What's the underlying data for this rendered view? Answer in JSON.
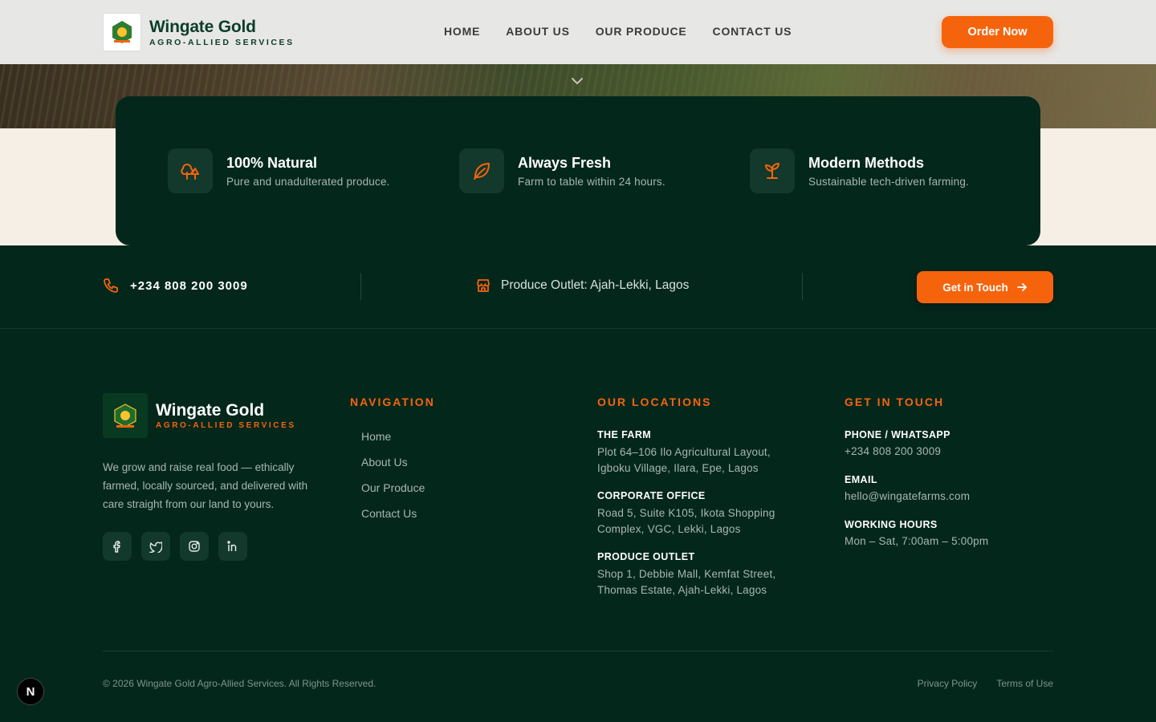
{
  "header": {
    "brand_name": "Wingate Gold",
    "brand_tagline": "AGRO-ALLIED SERVICES",
    "nav": [
      "HOME",
      "ABOUT US",
      "OUR PRODUCE",
      "CONTACT US"
    ],
    "cta_label": "Order Now"
  },
  "features": [
    {
      "title": "100% Natural",
      "desc": "Pure and unadulterated produce.",
      "icon": "trees-icon"
    },
    {
      "title": "Always Fresh",
      "desc": "Farm to table within 24 hours.",
      "icon": "leaf-icon"
    },
    {
      "title": "Modern Methods",
      "desc": "Sustainable tech-driven farming.",
      "icon": "sprout-icon"
    }
  ],
  "contact_bar": {
    "phone": "+234 808 200 3009",
    "outlet": "Produce Outlet: Ajah-Lekki, Lagos",
    "cta_label": "Get in Touch"
  },
  "footer": {
    "brand_name": "Wingate Gold",
    "brand_tagline": "AGRO-ALLIED SERVICES",
    "about": "We grow and raise real food — ethically farmed, locally sourced, and delivered with care straight from our land to yours.",
    "socials": [
      "facebook-icon",
      "twitter-icon",
      "instagram-icon",
      "linkedin-icon"
    ],
    "navigation": {
      "heading": "NAVIGATION",
      "links": [
        "Home",
        "About Us",
        "Our Produce",
        "Contact Us"
      ]
    },
    "locations": {
      "heading": "OUR LOCATIONS",
      "items": [
        {
          "title": "THE FARM",
          "line1": "Plot 64–106 Ilo Agricultural Layout,",
          "line2": "Igboku Village, Ilara, Epe, Lagos"
        },
        {
          "title": "CORPORATE OFFICE",
          "line1": "Road 5, Suite K105, Ikota Shopping",
          "line2": "Complex, VGC, Lekki, Lagos"
        },
        {
          "title": "PRODUCE OUTLET",
          "line1": "Shop 1, Debbie Mall, Kemfat Street,",
          "line2": "Thomas Estate, Ajah-Lekki, Lagos"
        }
      ]
    },
    "get_in_touch": {
      "heading": "GET IN TOUCH",
      "items": [
        {
          "title": "PHONE / WHATSAPP",
          "value": "+234 808 200 3009"
        },
        {
          "title": "EMAIL",
          "value": "hello@wingatefarms.com"
        },
        {
          "title": "WORKING HOURS",
          "value": "Mon – Sat, 7:00am – 5:00pm"
        }
      ]
    },
    "copyright": "© 2026 Wingate Gold Agro-Allied Services. All Rights Reserved.",
    "legal": [
      "Privacy Policy",
      "Terms of Use"
    ]
  },
  "dev_badge": "N",
  "colors": {
    "accent": "#f5640c",
    "dark_green": "#04271c",
    "cream": "#f6efe6"
  }
}
